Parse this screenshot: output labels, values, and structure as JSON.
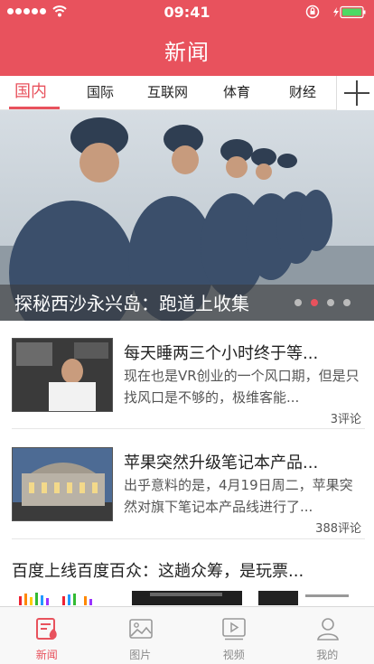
{
  "status_bar": {
    "time": "09:41"
  },
  "nav": {
    "title": "新闻"
  },
  "tabs": [
    {
      "label": "国内",
      "active": true
    },
    {
      "label": "国际"
    },
    {
      "label": "互联网"
    },
    {
      "label": "体育"
    },
    {
      "label": "财经"
    }
  ],
  "add_tab_icon": "plus-icon",
  "banner": {
    "caption": "探秘西沙永兴岛：跑道上收集",
    "page_count": 4,
    "current_page": 2
  },
  "news": [
    {
      "title": "每天睡两三个小时终于等...",
      "desc": "现在也是VR创业的一个风口期，但是只找风口是不够的，极维客能...",
      "comments": "3评论"
    },
    {
      "title": "苹果突然升级笔记本产品...",
      "desc": "出乎意料的是，4月19日周二，苹果突然对旗下笔记本产品线进行了...",
      "comments": "388评论"
    },
    {
      "title": "百度上线百度百众：这趟众筹，是玩票..."
    }
  ],
  "tabbar": [
    {
      "label": "新闻",
      "icon": "news-icon",
      "active": true
    },
    {
      "label": "图片",
      "icon": "picture-icon"
    },
    {
      "label": "视频",
      "icon": "video-icon"
    },
    {
      "label": "我的",
      "icon": "profile-icon"
    }
  ],
  "colors": {
    "accent": "#e8525d",
    "tabbar_bg": "#f8f8f8"
  }
}
